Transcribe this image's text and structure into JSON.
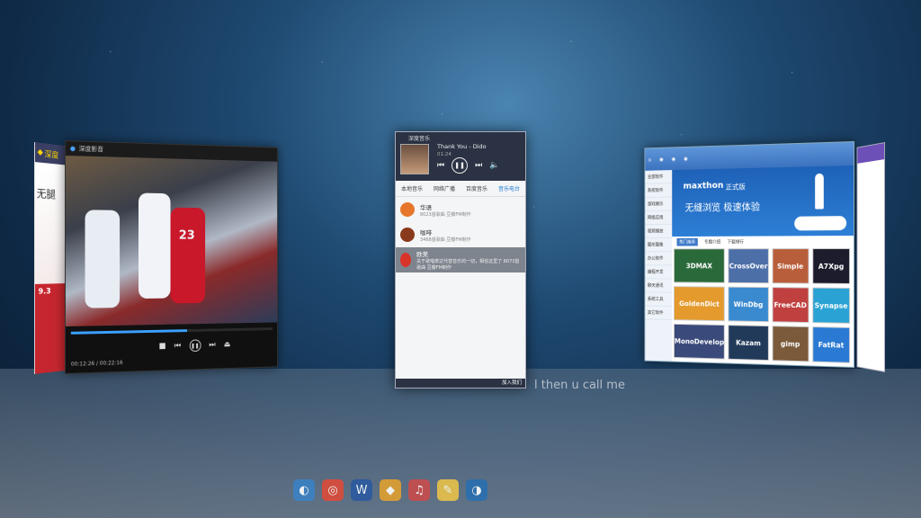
{
  "store": {
    "head": "深度",
    "banner_text": "无腿",
    "badge": "9.3"
  },
  "video": {
    "title": "深度影音",
    "jersey": "23",
    "time": "00:12:26 / 00:22:16",
    "progress": 0.56
  },
  "music": {
    "title": "深度音乐",
    "song": "Thank You - Dido",
    "time": "01:24",
    "tabs": [
      "本地音乐",
      "网络广播",
      "百度音乐",
      "音乐电台"
    ],
    "active_tab": 3,
    "stations": [
      {
        "name": "华语",
        "sub": "8023首歌曲 豆瓣FM制作",
        "color": "#e6762b"
      },
      {
        "name": "咖啡",
        "sub": "3468首歌曲 豆瓣FM制作",
        "color": "#8a3a1c"
      },
      {
        "name": "欧美",
        "sub": "关于歌唱表达代替音乐的一切，相信这里了 8073首歌曲 豆瓣FM制作",
        "color": "#d9342a",
        "selected": true
      }
    ],
    "footer": "加入我们"
  },
  "lyric": "l then u call me",
  "browser": {
    "logo": "maxthon",
    "tag": "正式版",
    "slogan": "无缝浏览   极速体验",
    "subtabs": [
      "热门推荐",
      "专题介绍",
      "下载排行"
    ],
    "side": [
      "全部软件",
      "系统软件",
      "游戏娱乐",
      "网络应用",
      "视频播放",
      "图形图像",
      "办公软件",
      "编程开发",
      "聊天通讯",
      "系统工具",
      "其它软件"
    ],
    "tiles": [
      {
        "label": "3DMAX",
        "bg": "#2a6a3a"
      },
      {
        "label": "CrossOver",
        "bg": "#4d6fa8"
      },
      {
        "label": "Simple",
        "bg": "#b95e3a"
      },
      {
        "label": "A7Xpg",
        "bg": "#1c1c2c"
      },
      {
        "label": "GoldenDict",
        "bg": "#e49a2c"
      },
      {
        "label": "WinDbg",
        "bg": "#3a8ad0"
      },
      {
        "label": "FreeCAD",
        "bg": "#c04040"
      },
      {
        "label": "Synapse",
        "bg": "#2aa3d4"
      },
      {
        "label": "MonoDevelop",
        "bg": "#3a4a7a"
      },
      {
        "label": "Kazam",
        "bg": "#223a5a"
      },
      {
        "label": "gimp",
        "bg": "#7a5a3a"
      },
      {
        "label": "FatRat",
        "bg": "#2a7ad4"
      }
    ]
  },
  "dock_icons": [
    "deepin-icon",
    "chrome-icon",
    "wps-icon",
    "store-icon",
    "music-icon",
    "notes-icon",
    "settings-icon"
  ]
}
